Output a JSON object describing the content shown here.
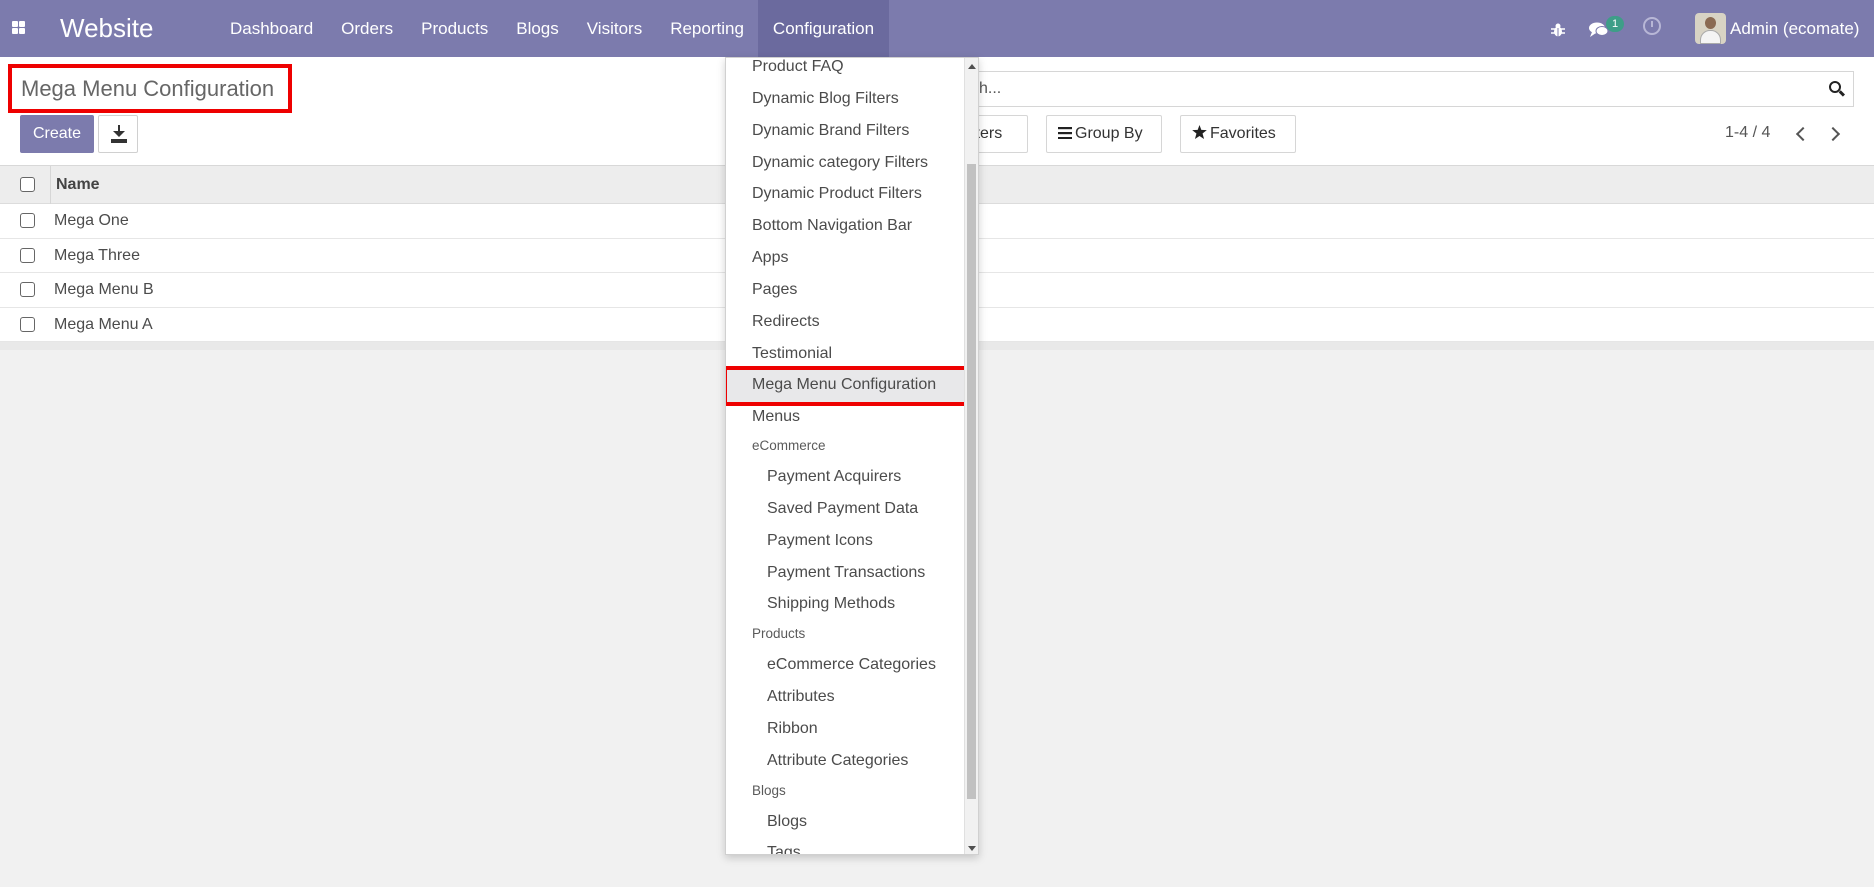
{
  "navbar": {
    "brand": "Website",
    "menu": [
      "Dashboard",
      "Orders",
      "Products",
      "Blogs",
      "Visitors",
      "Reporting",
      "Configuration"
    ],
    "chat_badge": "1",
    "user": "Admin (ecomate)",
    "icons": [
      "apps-icon",
      "bug-icon",
      "chat-icon",
      "clock-icon"
    ]
  },
  "control_panel": {
    "title": "Mega Menu Configuration",
    "create_label": "Create",
    "search_text": "ch...",
    "filters_label": "lters",
    "groupby_label": "Group By",
    "favorites_label": "Favorites",
    "pager": "1-4 / 4"
  },
  "list": {
    "columns": [
      "Name"
    ],
    "rows": [
      "Mega One",
      "Mega Three",
      "Mega Menu B",
      "Mega Menu A"
    ]
  },
  "dropdown": {
    "items": {
      "product_faq": "Product FAQ",
      "dynamic_blog_filters": "Dynamic Blog Filters",
      "dynamic_brand_filters": "Dynamic Brand Filters",
      "dynamic_category_filters": "Dynamic category Filters",
      "dynamic_product_filters": "Dynamic Product Filters",
      "bottom_navigation_bar": "Bottom Navigation Bar",
      "apps": "Apps",
      "pages": "Pages",
      "redirects": "Redirects",
      "testimonial": "Testimonial",
      "mega_menu_configuration": "Mega Menu Configuration",
      "menus": "Menus",
      "ecommerce_header": "eCommerce",
      "payment_acquirers": "Payment Acquirers",
      "saved_payment_data": "Saved Payment Data",
      "payment_icons": "Payment Icons",
      "payment_transactions": "Payment Transactions",
      "shipping_methods": "Shipping Methods",
      "products_header": "Products",
      "ecommerce_categories": "eCommerce Categories",
      "attributes": "Attributes",
      "ribbon": "Ribbon",
      "attribute_categories": "Attribute Categories",
      "blogs_header": "Blogs",
      "blogs": "Blogs",
      "tags": "Tags"
    }
  },
  "colors": {
    "navbar": "#7c7bad",
    "highlight": "#ee0000",
    "badge": "#3e9e88"
  }
}
